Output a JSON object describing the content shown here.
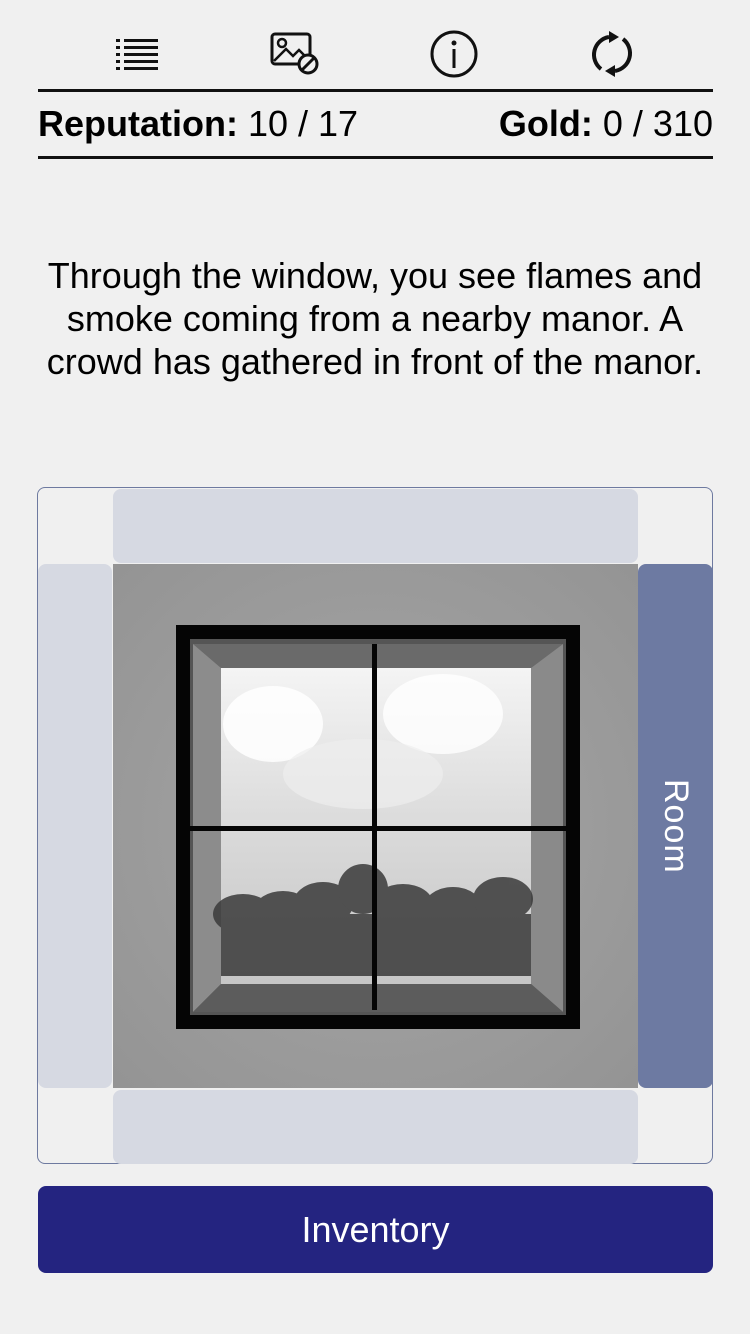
{
  "toolbar": {
    "icons": [
      "list-icon",
      "image-off-icon",
      "info-icon",
      "restart-icon"
    ]
  },
  "stats": {
    "reputation_label": "Reputation:",
    "reputation_value": "10 / 17",
    "gold_label": "Gold:",
    "gold_value": "0 / 310"
  },
  "narration": "Through the window, you see flames and smoke coming from a nearby manor. A crowd has gathered in front of the manor.",
  "navigation": {
    "right_label": "Room"
  },
  "inventory_label": "Inventory",
  "colors": {
    "background": "#f0f0f0",
    "nav_inactive": "#d6d9e2",
    "nav_active": "#6d7aa2",
    "inventory_button": "#242480"
  }
}
